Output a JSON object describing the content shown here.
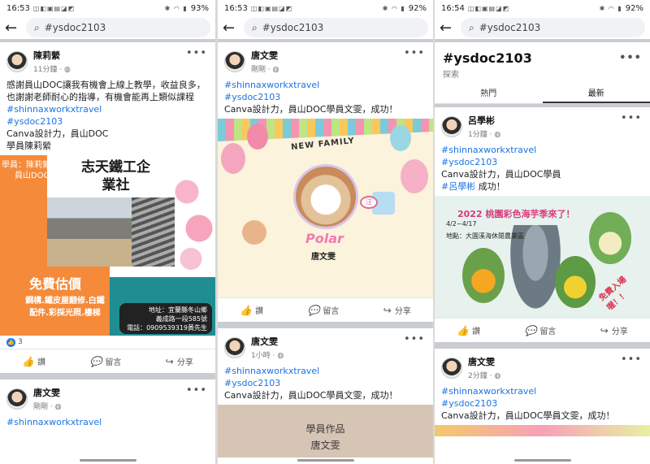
{
  "status_bars": [
    {
      "time": "16:53",
      "battery": "93%"
    },
    {
      "time": "16:53",
      "battery": "92%"
    },
    {
      "time": "16:54",
      "battery": "92%"
    }
  ],
  "search": {
    "query": "#ysdoc2103"
  },
  "hashtag_page": {
    "title": "#ysdoc2103",
    "subtitle": "探索",
    "tab_hot": "熱門",
    "tab_latest": "最新"
  },
  "actions": {
    "like": "讚",
    "comment": "留言",
    "share": "分享"
  },
  "pane1": {
    "post1": {
      "author": "陳莉縈",
      "time": "11分鐘 · ",
      "line1": "感謝員山DOC讓我有機會上線上教學，收益良多，也謝謝老師耐心的指導，有機會能再上類似課程",
      "tag1": "#shinnaxworkxtravel",
      "tag2": "#ysdoc2103",
      "line2": "Canva設計力，員山DOC",
      "line3": "學員陳莉縈",
      "image": {
        "student_line1": "學員：陳莉縈",
        "student_line2": "員山DOC",
        "title_line1": "志天鐵工企",
        "title_line2": "業社",
        "estimate": "免費估價",
        "services_line1": "鋼構.鐵皮屋翻修.白鐵",
        "services_line2": "配件.彩採光照.樓梯",
        "addr_line1": "地址：宜蘭縣冬山鄉",
        "addr_line2": "義成路一段585號",
        "addr_line3": "電話：0909539319黃先生"
      },
      "reaction_count": "3"
    },
    "post2": {
      "author": "唐文雯",
      "time": "剛剛 · ",
      "tag1": "#shinnaxworkxtravel"
    }
  },
  "pane2": {
    "post1": {
      "author": "唐文雯",
      "time": "剛剛 · ",
      "tag1": "#shinnaxworkxtravel",
      "tag2": "#ysdoc2103",
      "line1": "Canva設計力，員山DOC學員文雯，成功！",
      "image": {
        "heading": "NEW FAMILY",
        "badge": "汪",
        "pet_name": "Polar",
        "owner": "唐文雯"
      }
    },
    "post2": {
      "author": "唐文雯",
      "time": "1小時 · ",
      "tag1": "#shinnaxworkxtravel",
      "tag2": "#ysdoc2103",
      "line1": "Canva設計力，員山DOC學員文雯，成功！",
      "image": {
        "line1": "學員作品",
        "line2": "唐文雯"
      }
    }
  },
  "pane3": {
    "post1": {
      "author": "呂學彬",
      "time": "1分鐘 · ",
      "tag1": "#shinnaxworkxtravel",
      "tag2": "#ysdoc2103",
      "line1": "Canva設計力，員山DOC學員",
      "tag3": "#呂學彬",
      "line2_suffix": " 成功！",
      "image": {
        "heading": "2022 桃園彩色海芋季來了！",
        "date": "4/2~4/17",
        "place": "地點：大園溪海休閒農業區",
        "free": "免費入場喔！！"
      }
    },
    "post2": {
      "author": "唐文雯",
      "time": "2分鐘 · ",
      "tag1": "#shinnaxworkxtravel",
      "tag2": "#ysdoc2103",
      "line1": "Canva設計力，員山DOC學員文雯，成功！"
    }
  },
  "colors": {
    "link": "#1b74e4",
    "divider": "#c9ccd1",
    "like_blue": "#1877f2"
  }
}
